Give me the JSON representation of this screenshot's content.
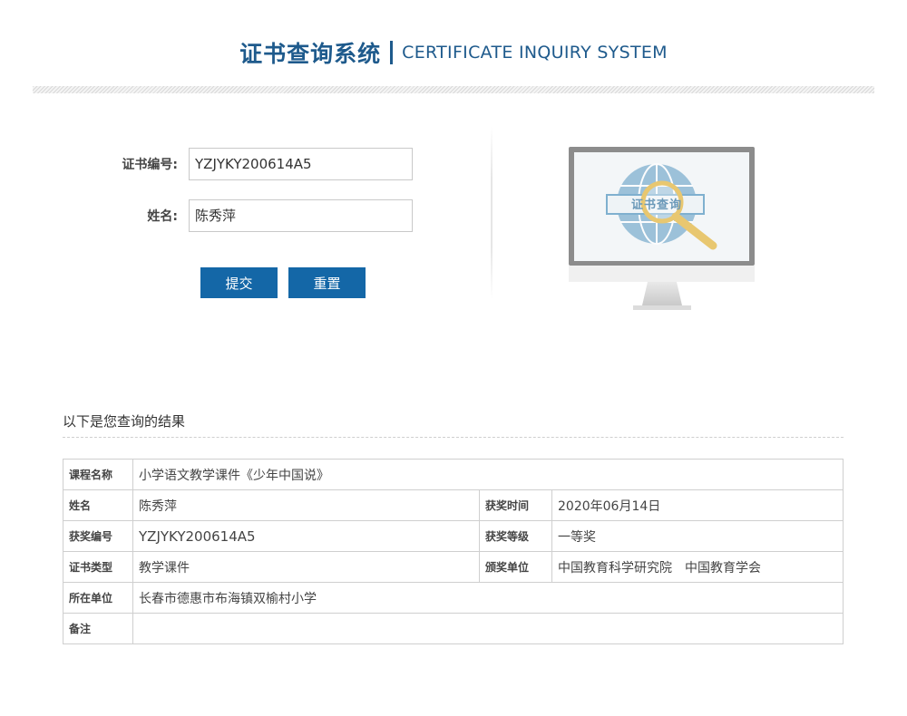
{
  "header": {
    "title_zh": "证书查询系统",
    "title_en": "CERTIFICATE INQUIRY SYSTEM"
  },
  "form": {
    "cert_no_label": "证书编号:",
    "cert_no_value": "YZJYKY200614A5",
    "name_label": "姓名:",
    "name_value": "陈秀萍",
    "submit_label": "提交",
    "reset_label": "重置"
  },
  "illustration": {
    "screen_text": "证书查询",
    "icon": "monitor-magnifier-globe"
  },
  "results": {
    "heading": "以下是您查询的结果",
    "rows": {
      "course_label": "课程名称",
      "course_value": "小学语文教学课件《少年中国说》",
      "name_label": "姓名",
      "name_value": "陈秀萍",
      "award_time_label": "获奖时间",
      "award_time_value": "2020年06月14日",
      "award_no_label": "获奖编号",
      "award_no_value": "YZJYKY200614A5",
      "award_level_label": "获奖等级",
      "award_level_value": "一等奖",
      "cert_type_label": "证书类型",
      "cert_type_value": "教学课件",
      "issuer_label": "颁奖单位",
      "issuer_value": "中国教育科学研究院　中国教育学会",
      "unit_label": "所在单位",
      "unit_value": "长春市德惠市布海镇双榆村小学",
      "remark_label": "备注",
      "remark_value": ""
    }
  },
  "colors": {
    "brand": "#1e5a8c",
    "button": "#1467a7",
    "border": "#cfcfcf"
  }
}
